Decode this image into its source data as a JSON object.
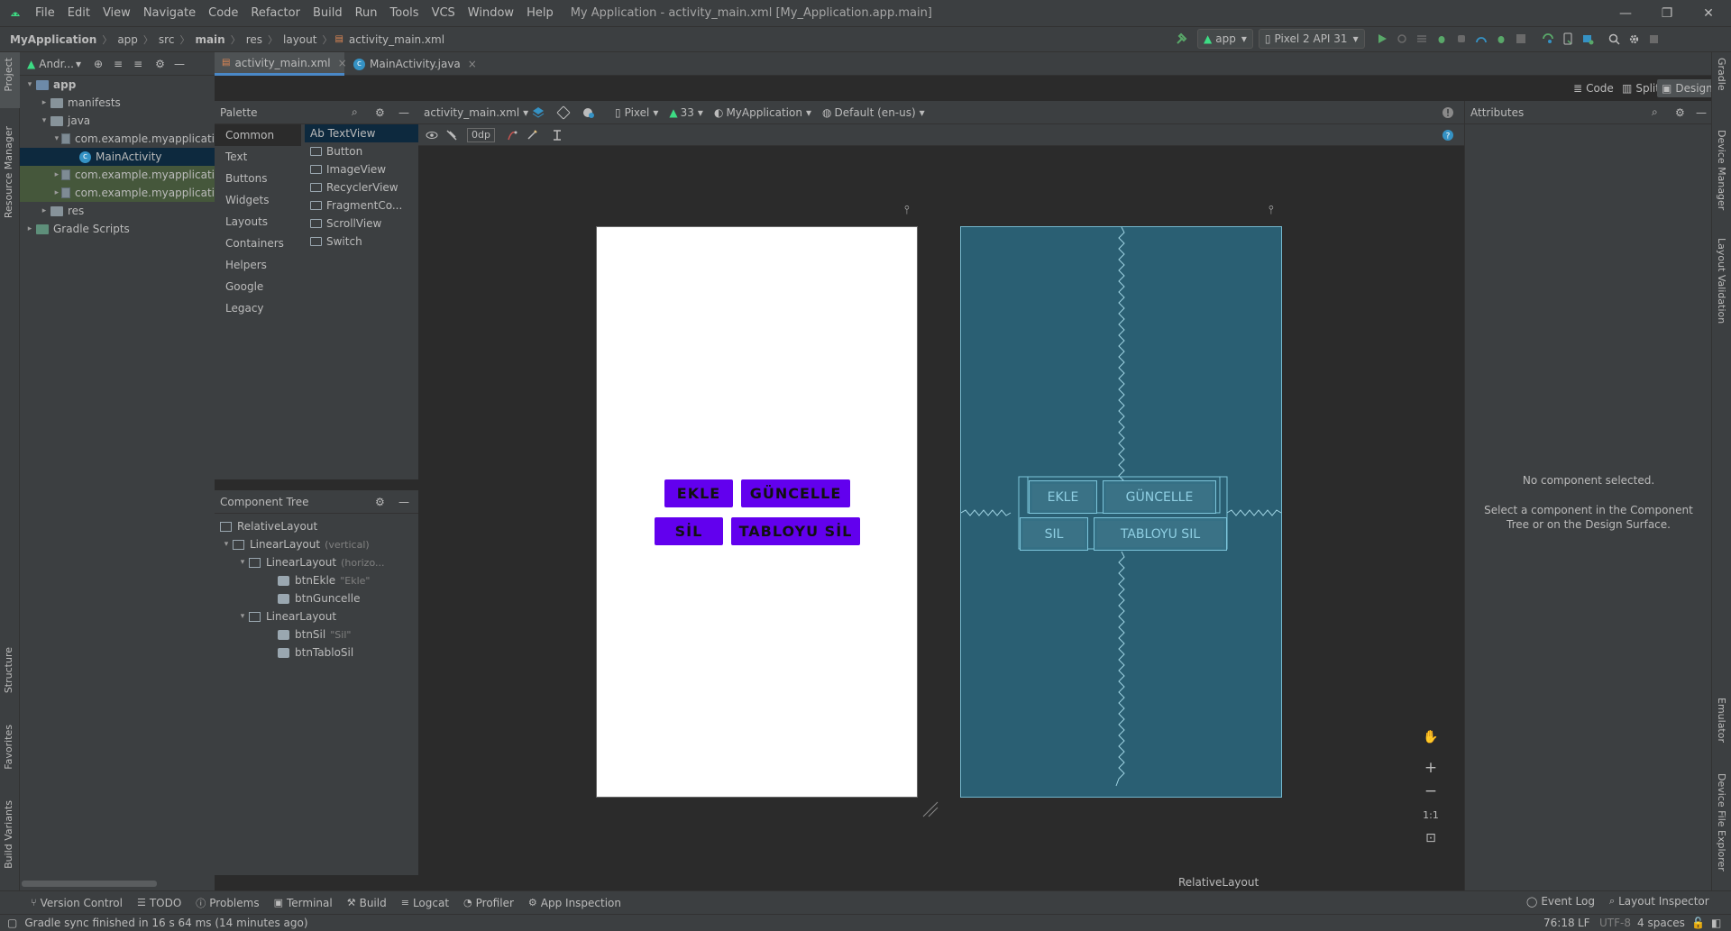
{
  "menu": {
    "items": [
      "File",
      "Edit",
      "View",
      "Navigate",
      "Code",
      "Refactor",
      "Build",
      "Run",
      "Tools",
      "VCS",
      "Window",
      "Help"
    ],
    "window_title": "My Application - activity_main.xml [My_Application.app.main]"
  },
  "breadcrumbs": [
    "MyApplication",
    "app",
    "src",
    "main",
    "res",
    "layout",
    "activity_main.xml"
  ],
  "run_config": {
    "module": "app",
    "device": "Pixel 2 API 31"
  },
  "project_panel": {
    "view_label": "Andr...",
    "tree": [
      {
        "label": "app",
        "depth": 0,
        "arrow": "▾",
        "kind": "folder-blue"
      },
      {
        "label": "manifests",
        "depth": 1,
        "arrow": "▸",
        "kind": "folder"
      },
      {
        "label": "java",
        "depth": 1,
        "arrow": "▾",
        "kind": "folder"
      },
      {
        "label": "com.example.myapplicati",
        "depth": 2,
        "arrow": "▾",
        "kind": "package"
      },
      {
        "label": "MainActivity",
        "depth": 3,
        "arrow": "",
        "kind": "class",
        "selected": true
      },
      {
        "label": "com.example.myapplicati",
        "depth": 2,
        "arrow": "▸",
        "kind": "package",
        "highlight": true
      },
      {
        "label": "com.example.myapplicati",
        "depth": 2,
        "arrow": "▸",
        "kind": "package",
        "highlight": true
      },
      {
        "label": "res",
        "depth": 1,
        "arrow": "▸",
        "kind": "folder"
      },
      {
        "label": "Gradle Scripts",
        "depth": 0,
        "arrow": "▸",
        "kind": "gradle"
      }
    ]
  },
  "left_tabs": [
    "Project",
    "Resource Manager",
    "Structure",
    "Favorites",
    "Build Variants"
  ],
  "right_tabs": [
    "Gradle",
    "Device Manager",
    "Layout Validation",
    "Emulator",
    "Device File Explorer"
  ],
  "editor_tabs": [
    {
      "label": "activity_main.xml",
      "active": true
    },
    {
      "label": "MainActivity.java",
      "active": false
    }
  ],
  "view_modes": {
    "code": "Code",
    "split": "Split",
    "design": "Design"
  },
  "palette": {
    "title": "Palette",
    "categories": [
      "Common",
      "Text",
      "Buttons",
      "Widgets",
      "Layouts",
      "Containers",
      "Helpers",
      "Google",
      "Legacy"
    ],
    "items": [
      "Ab TextView",
      "Button",
      "ImageView",
      "RecyclerView",
      "FragmentCo...",
      "ScrollView",
      "Switch"
    ]
  },
  "design_toolbar": {
    "file": "activity_main.xml",
    "device": "Pixel",
    "api": "33",
    "theme": "MyApplication",
    "locale": "Default (en-us)",
    "margin": "0dp"
  },
  "component_tree": {
    "title": "Component Tree",
    "items": [
      {
        "label": "RelativeLayout",
        "depth": 0,
        "arrow": "",
        "icon": "layout",
        "hint": ""
      },
      {
        "label": "LinearLayout",
        "depth": 0,
        "arrow": "▾",
        "icon": "linear-v",
        "hint": "(vertical)"
      },
      {
        "label": "LinearLayout",
        "depth": 1,
        "arrow": "▾",
        "icon": "linear-h",
        "hint": "(horizo..."
      },
      {
        "label": "btnEkle",
        "depth": 2,
        "arrow": "",
        "icon": "button",
        "hint": "\"Ekle\""
      },
      {
        "label": "btnGuncelle",
        "depth": 2,
        "arrow": "",
        "icon": "button",
        "hint": ""
      },
      {
        "label": "LinearLayout",
        "depth": 1,
        "arrow": "▾",
        "icon": "linear-h",
        "hint": ""
      },
      {
        "label": "btnSil",
        "depth": 2,
        "arrow": "",
        "icon": "button",
        "hint": "\"Sil\""
      },
      {
        "label": "btnTabloSil",
        "depth": 2,
        "arrow": "",
        "icon": "button",
        "hint": ""
      }
    ]
  },
  "preview": {
    "buttons": {
      "ekle": "EKLE",
      "guncelle": "GÜNCELLE",
      "sil": "SİL",
      "tabloyu_sil": "TABLOYU SİL"
    },
    "blueprint_buttons": {
      "ekle": "EKLE",
      "guncelle": "GÜNCELLE",
      "sil": "SIL",
      "tabloyu_sil": "TABLOYU SIL"
    },
    "accent_color": "#6200ee",
    "blueprint_color": "#2a5f73"
  },
  "zoom": {
    "reset": "1:1"
  },
  "breadcrumb_bottom": "RelativeLayout",
  "attributes": {
    "title": "Attributes",
    "empty_title": "No component selected.",
    "empty_hint": "Select a component in the Component Tree or on the Design Surface."
  },
  "tool_windows": [
    "Version Control",
    "TODO",
    "Problems",
    "Terminal",
    "Build",
    "Logcat",
    "Profiler",
    "App Inspection"
  ],
  "tool_windows_right": [
    "Event Log",
    "Layout Inspector"
  ],
  "status": {
    "message": "Gradle sync finished in 16 s 64 ms (14 minutes ago)",
    "position": "76:18",
    "line_sep": "LF",
    "encoding": "UTF-8",
    "indent": "4 spaces"
  }
}
